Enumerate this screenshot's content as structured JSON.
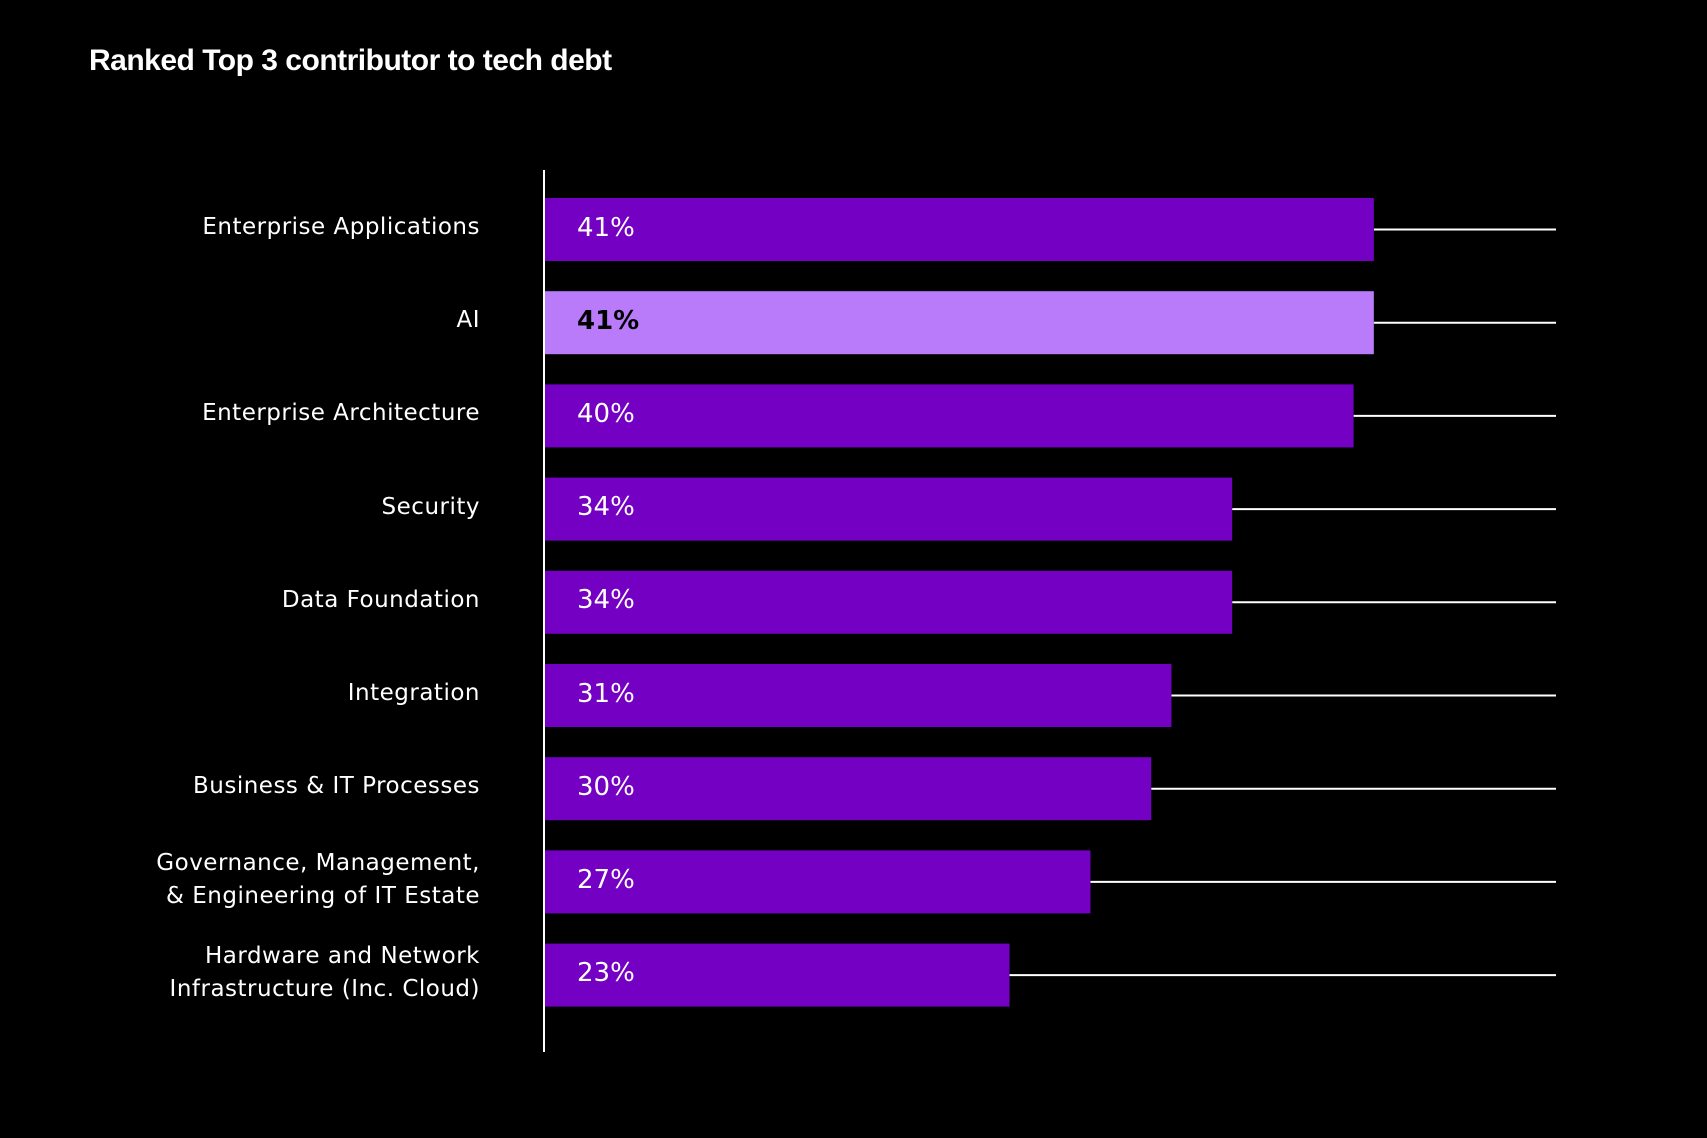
{
  "chart_data": {
    "type": "bar",
    "orientation": "horizontal",
    "title": "Ranked Top 3 contributor to tech debt",
    "categories": [
      "Enterprise Applications",
      "AI",
      "Enterprise Architecture",
      "Security",
      "Data Foundation",
      "Integration",
      "Business & IT Processes",
      "Governance, Management,\n& Engineering of IT Estate",
      "Hardware and Network\nInfrastructure (Inc. Cloud)"
    ],
    "values": [
      41,
      41,
      40,
      34,
      34,
      31,
      30,
      27,
      23
    ],
    "value_labels": [
      "41%",
      "41%",
      "40%",
      "34%",
      "34%",
      "31%",
      "30%",
      "27%",
      "23%"
    ],
    "unit": "%",
    "xlim": [
      0,
      50
    ],
    "highlight_index": 1,
    "grid": false,
    "colors": {
      "bar": "#7300C3",
      "highlight": "#B97BFA",
      "background": "#000000",
      "track": "#FFFFFF"
    }
  }
}
